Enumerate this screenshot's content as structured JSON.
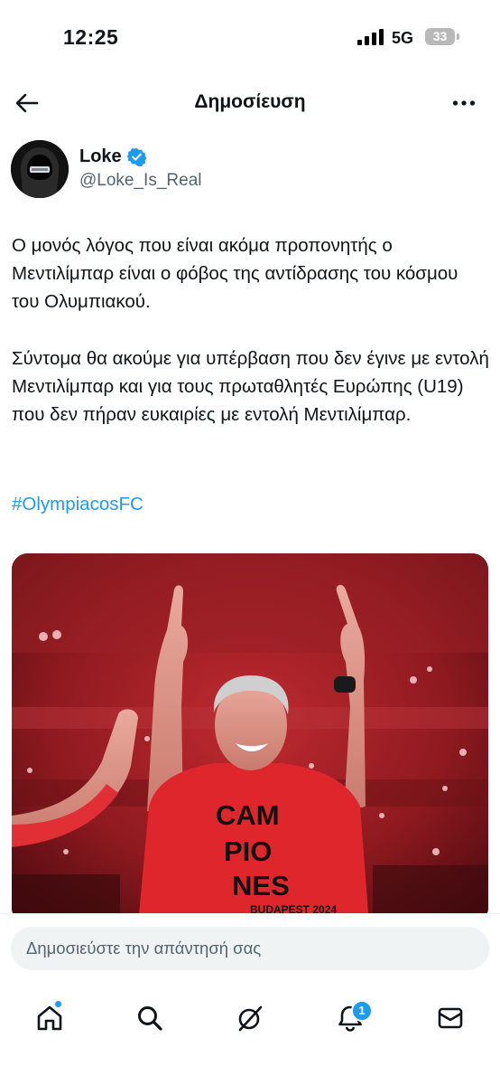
{
  "status": {
    "time": "12:25",
    "network": "5G",
    "battery": "33"
  },
  "header": {
    "title": "Δημοσίευση"
  },
  "author": {
    "display_name": "Loke",
    "handle": "@Loke_Is_Real"
  },
  "tweet": {
    "paragraphs": [
      "Ο μονός λόγος που είναι ακόμα προπονητής ο Μεντιλίμπαρ είναι ο φόβος της αντίδρασης του κόσμου του Ολυμπιακού.",
      "Σύντομα θα ακούμε για υπέρβαση που δεν έγινε με εντολή Μεντιλίμπαρ και για τους πρωταθλητές Ευρώπης (U19) που δεν πήραν ευκαιρίες με εντολή Μεντιλίμπαρ."
    ],
    "hashtag": "#OlympiacosFC"
  },
  "media": {
    "shirt_lines": [
      "CAM",
      "PIO",
      "NES",
      "BUDAPEST 2024"
    ]
  },
  "reply": {
    "placeholder": "Δημοσιεύστε την απάντησή σας"
  },
  "tabbar": {
    "notification_count": "1"
  },
  "colors": {
    "accent": "#1d9bf0",
    "text": "#0f1419",
    "secondary": "#536471"
  }
}
